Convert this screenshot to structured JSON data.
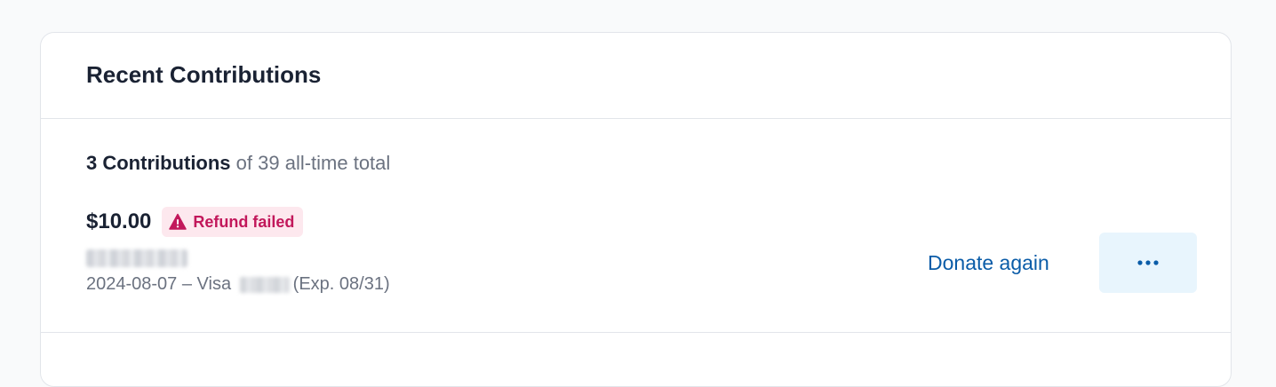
{
  "card": {
    "title": "Recent Contributions"
  },
  "summary": {
    "count_label": "3 Contributions",
    "total_label": " of 39 all-time total"
  },
  "contribution": {
    "amount": "$10.00",
    "status_badge": "Refund failed",
    "status_icon": "warning-triangle-icon",
    "date_payment": "2024-08-07 – Visa ",
    "expiry": "(Exp. 08/31)",
    "donate_again_label": "Donate again",
    "more_icon": "ellipsis-icon"
  },
  "colors": {
    "title_text": "#1a2233",
    "muted_text": "#6b7280",
    "badge_bg": "#fde8ee",
    "badge_text": "#c2185b",
    "link": "#0a5ca8",
    "more_button_bg": "#e8f5fd"
  }
}
